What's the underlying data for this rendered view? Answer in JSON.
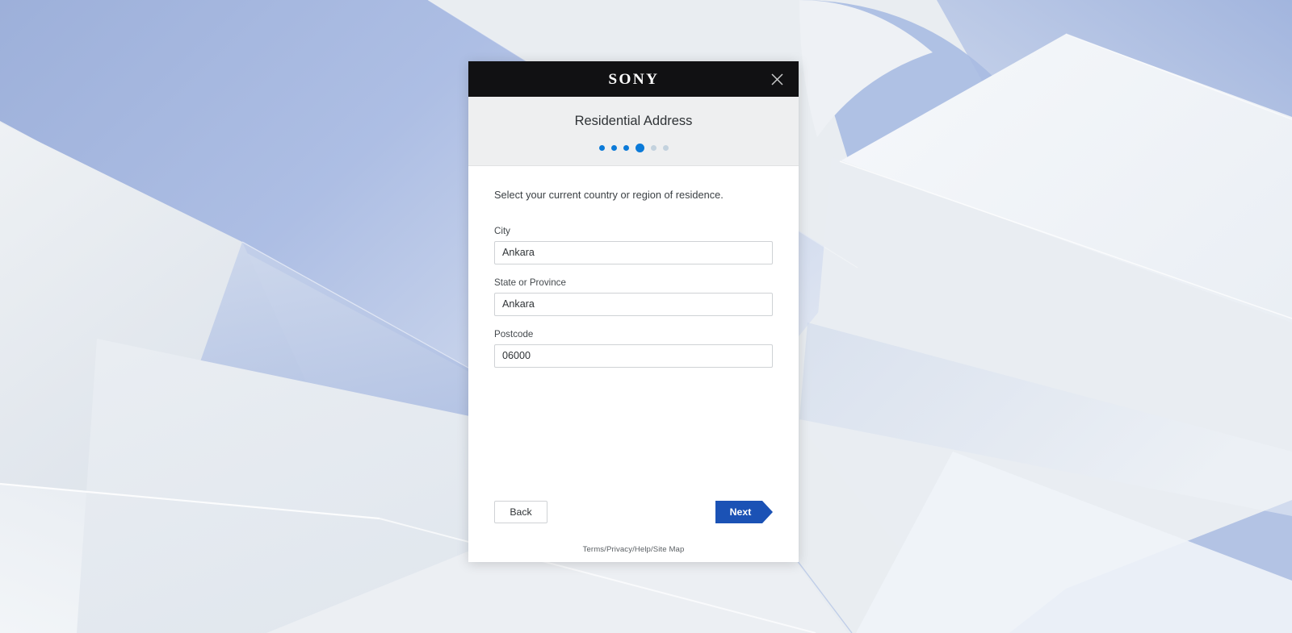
{
  "window": {
    "brand_logo": "SONY",
    "close_icon": "close-x-icon",
    "title": "Residential Address"
  },
  "stepper": {
    "total_steps": 6,
    "current_step": 4,
    "active_color": "#0b7ad8",
    "inactive_color": "#c3d2de",
    "steps": [
      {
        "state": "done"
      },
      {
        "state": "done"
      },
      {
        "state": "done"
      },
      {
        "state": "active"
      },
      {
        "state": "upcoming"
      },
      {
        "state": "upcoming"
      }
    ]
  },
  "form": {
    "intro_text": "Select your current country or region of residence.",
    "fields": [
      {
        "label": "City",
        "value": "Ankara",
        "placeholder": ""
      },
      {
        "label": "State or Province",
        "value": "Ankara",
        "placeholder": ""
      },
      {
        "label": "Postcode",
        "value": "06000",
        "placeholder": ""
      }
    ]
  },
  "actions": {
    "back_label": "Back",
    "next_label": "Next",
    "next_color": "#1b52b5"
  },
  "footer": {
    "links_text": "Terms/Privacy/Help/Site Map"
  },
  "desktop": {
    "wallpaper_colors": {
      "base": "#e9edf1",
      "blue": "#a9bbe2",
      "blue_light": "#c3d0e9",
      "gray_light": "#e4e9ee",
      "white": "#f4f7fa"
    }
  }
}
